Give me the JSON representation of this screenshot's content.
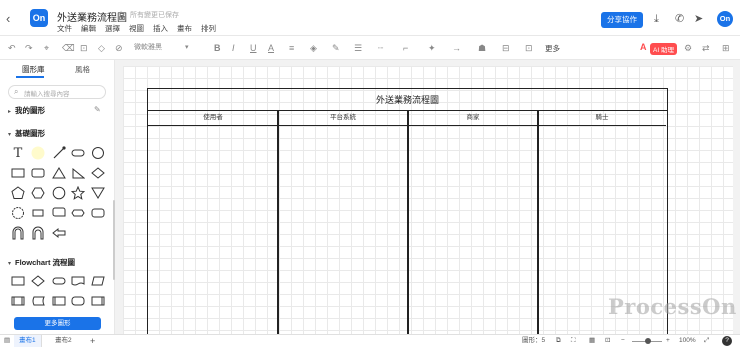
{
  "app": {
    "logo": "On",
    "title": "外送業務流程圖",
    "star_icon": "star-icon",
    "saved": "所有變更已保存",
    "share": "分享協作",
    "avatar": "On"
  },
  "menu": [
    "文件",
    "編輯",
    "選擇",
    "視圖",
    "插入",
    "畫布",
    "排列"
  ],
  "toolbar": {
    "font": "微軟雅黑",
    "font_size": "",
    "more": "更多",
    "ai_badge": "AI 助理",
    "ai_letter": "A"
  },
  "sidebar": {
    "tabs": [
      "圖形庫",
      "風格"
    ],
    "search_placeholder": "請輸入搜尋內容",
    "sections": [
      "我的圖形",
      "基礎圖形",
      "Flowchart 流程圖"
    ],
    "text_tool": "T",
    "more_shapes": "更多圖形"
  },
  "diagram": {
    "title": "外送業務流程圖",
    "lanes": [
      "使用者",
      "平台系統",
      "商家",
      "騎士"
    ]
  },
  "watermark": "ProcessOn",
  "statusbar": {
    "pages": [
      "畫布1",
      "畫布2"
    ],
    "add": "+",
    "shapes_label": "圖形：5",
    "zoom": "100%",
    "help": "?"
  },
  "colors": {
    "accent": "#1a73e8",
    "ai": "#ff4d4f",
    "swatch": "#fffbcc"
  }
}
